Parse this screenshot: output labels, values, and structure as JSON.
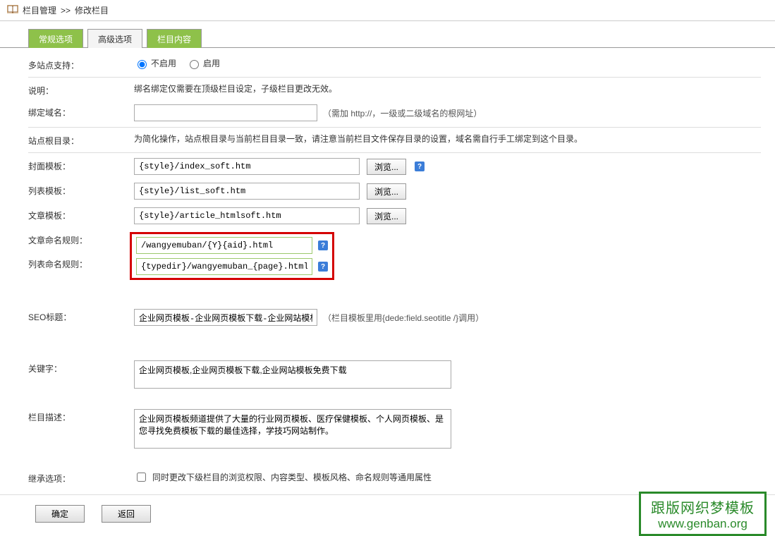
{
  "breadcrumb": {
    "section": "栏目管理",
    "sep": ">>",
    "page": "修改栏目"
  },
  "tabs": {
    "general": "常规选项",
    "advanced": "高级选项",
    "content": "栏目内容"
  },
  "rows": {
    "multisite": {
      "label": "多站点支持：",
      "opt_off": "不启用",
      "opt_on": "启用"
    },
    "desc": {
      "label": "说明：",
      "text": "绑名绑定仅需要在顶级栏目设定，子级栏目更改无效。"
    },
    "domain": {
      "label": "绑定域名：",
      "hint": "（需加 http://，一级或二级域名的根网址）"
    },
    "siteroot": {
      "label": "站点根目录：",
      "text": "为简化操作，站点根目录与当前栏目目录一致，请注意当前栏目文件保存目录的设置，域名需自行手工绑定到这个目录。"
    },
    "cover_tpl": {
      "label": "封面模板：",
      "value": "{style}/index_soft.htm",
      "btn": "浏览..."
    },
    "list_tpl": {
      "label": "列表模板：",
      "value": "{style}/list_soft.htm",
      "btn": "浏览..."
    },
    "article_tpl": {
      "label": "文章模板：",
      "value": "{style}/article_htmlsoft.htm",
      "btn": "浏览..."
    },
    "article_rule": {
      "label": "文章命名规则：",
      "value": "/wangyemuban/{Y}{aid}.html"
    },
    "list_rule": {
      "label": "列表命名规则：",
      "value": "{typedir}/wangyemuban_{page}.html"
    },
    "seo": {
      "label": "SEO标题：",
      "value": "企业网页模板-企业网页模板下载-企业网站模板",
      "hint": "（栏目模板里用{dede:field.seotitle /}调用）"
    },
    "keywords": {
      "label": "关键字：",
      "value": "企业网页模板,企业网页模板下载,企业网站模板免费下载"
    },
    "colum_desc": {
      "label": "栏目描述：",
      "value": "企业网页模板频道提供了大量的行业网页模板、医疗保健模板、个人网页模板、是您寻找免费模板下载的最佳选择，学技巧网站制作。"
    },
    "inherit": {
      "label": "继承选项：",
      "text": "同时更改下级栏目的浏览权限、内容类型、模板风格、命名规则等通用属性"
    }
  },
  "buttons": {
    "ok": "确定",
    "back": "返回"
  },
  "watermark": {
    "line1": "跟版网织梦模板",
    "line2": "www.genban.org"
  }
}
